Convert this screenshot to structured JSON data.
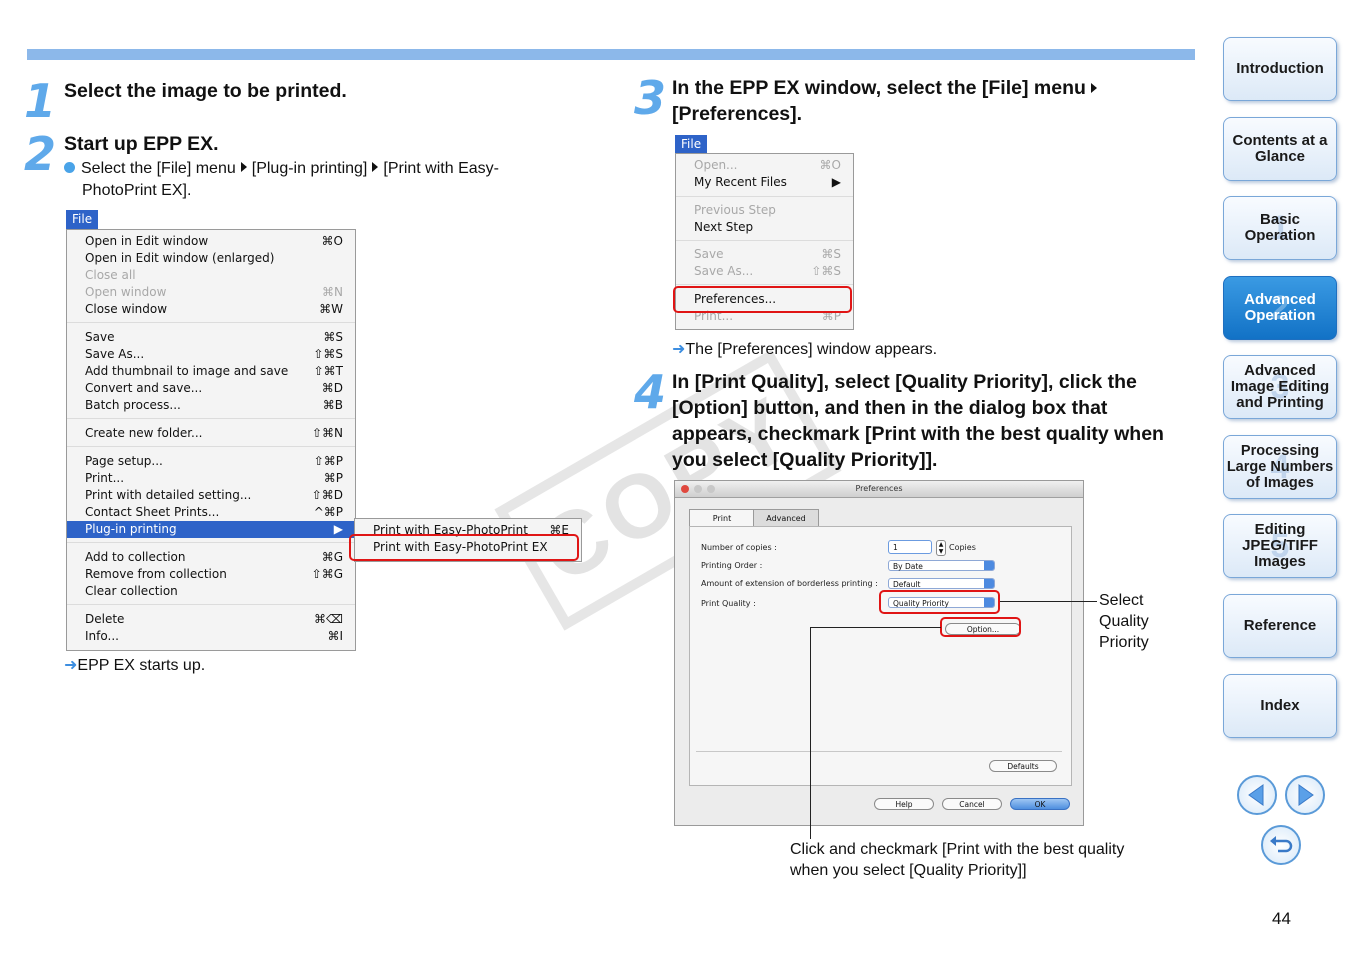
{
  "step1": {
    "num": "1",
    "title": "Select the image to be printed."
  },
  "step2": {
    "num": "2",
    "title": "Start up EPP EX.",
    "text_a": "Select the [File] menu",
    "text_b": "[Plug-in printing]",
    "text_c": "[Print with Easy-",
    "text_d": "PhotoPrint EX].",
    "result": "EPP EX starts up."
  },
  "file_menu_1": {
    "title": "File",
    "items": [
      {
        "label": "Open in Edit window",
        "shortcut": "⌘O",
        "disabled": false
      },
      {
        "label": "Open in Edit window (enlarged)",
        "shortcut": "",
        "disabled": false
      },
      {
        "label": "Close all",
        "shortcut": "",
        "disabled": true
      },
      {
        "label": "Open window",
        "shortcut": "⌘N",
        "disabled": true
      },
      {
        "label": "Close window",
        "shortcut": "⌘W",
        "disabled": false
      },
      {
        "label": "Save",
        "shortcut": "⌘S",
        "disabled": false
      },
      {
        "label": "Save As...",
        "shortcut": "⇧⌘S",
        "disabled": false
      },
      {
        "label": "Add thumbnail to image and save",
        "shortcut": "⇧⌘T",
        "disabled": false
      },
      {
        "label": "Convert and save...",
        "shortcut": "⌘D",
        "disabled": false
      },
      {
        "label": "Batch process...",
        "shortcut": "⌘B",
        "disabled": false
      },
      {
        "label": "Create new folder...",
        "shortcut": "⇧⌘N",
        "disabled": false
      },
      {
        "label": "Page setup...",
        "shortcut": "⇧⌘P",
        "disabled": false
      },
      {
        "label": "Print...",
        "shortcut": "⌘P",
        "disabled": false
      },
      {
        "label": "Print with detailed setting...",
        "shortcut": "⇧⌘D",
        "disabled": false
      },
      {
        "label": "Contact Sheet Prints...",
        "shortcut": "^⌘P",
        "disabled": false
      },
      {
        "label": "Plug-in printing",
        "shortcut": "▶",
        "disabled": false
      },
      {
        "label": "Add to collection",
        "shortcut": "⌘G",
        "disabled": false
      },
      {
        "label": "Remove from collection",
        "shortcut": "⇧⌘G",
        "disabled": false
      },
      {
        "label": "Clear collection",
        "shortcut": "",
        "disabled": false
      },
      {
        "label": "Delete",
        "shortcut": "⌘⌫",
        "disabled": false
      },
      {
        "label": "Info...",
        "shortcut": "⌘I",
        "disabled": false
      }
    ],
    "submenu": [
      {
        "label": "Print with Easy-PhotoPrint",
        "shortcut": "⌘E"
      },
      {
        "label": "Print with Easy-PhotoPrint EX",
        "shortcut": ""
      }
    ]
  },
  "step3": {
    "num": "3",
    "title_a": "In the EPP EX window, select the [File] menu",
    "title_b": "[Preferences].",
    "result": "The [Preferences] window appears."
  },
  "file_menu_2": {
    "title": "File",
    "items": [
      {
        "label": "Open...",
        "shortcut": "⌘O",
        "disabled": true
      },
      {
        "label": "My Recent Files",
        "shortcut": "▶",
        "disabled": false
      },
      {
        "label": "Previous Step",
        "shortcut": "",
        "disabled": true
      },
      {
        "label": "Next Step",
        "shortcut": "",
        "disabled": false
      },
      {
        "label": "Save",
        "shortcut": "⌘S",
        "disabled": true
      },
      {
        "label": "Save As...",
        "shortcut": "⇧⌘S",
        "disabled": true
      },
      {
        "label": "Preferences...",
        "shortcut": "",
        "disabled": false
      },
      {
        "label": "Print...",
        "shortcut": "⌘P",
        "disabled": true
      }
    ]
  },
  "step4": {
    "num": "4",
    "lines": [
      "In [Print Quality], select [Quality Priority], click the",
      "[Option] button, and then in the dialog box that",
      "appears, checkmark [Print with the best quality when",
      "you select [Quality Priority]]."
    ]
  },
  "prefs": {
    "title": "Preferences",
    "tabs": [
      "Print",
      "Advanced"
    ],
    "copies_label": "Number of copies :",
    "copies_value": "1",
    "copies_unit": "Copies",
    "order_label": "Printing Order :",
    "order_value": "By Date",
    "ext_label": "Amount of extension of borderless printing :",
    "ext_value": "Default",
    "quality_label": "Print Quality :",
    "quality_value": "Quality Priority",
    "option_btn": "Option...",
    "defaults_btn": "Defaults",
    "help_btn": "Help",
    "cancel_btn": "Cancel",
    "ok_btn": "OK"
  },
  "callouts": {
    "select_qp": [
      "Select",
      "Quality",
      "Priority"
    ],
    "click_checkmark": [
      "Click and checkmark [Print with the best quality",
      "when you select [Quality Priority]]"
    ]
  },
  "watermark": "COPY",
  "nav": [
    {
      "label": "Introduction",
      "num": ""
    },
    {
      "label": "Contents at a Glance",
      "num": ""
    },
    {
      "label": "Basic Operation",
      "num": "1"
    },
    {
      "label": "Advanced Operation",
      "num": "2"
    },
    {
      "label": "Advanced Image Editing and Printing",
      "num": "3"
    },
    {
      "label": "Processing Large Numbers of Images",
      "num": "4"
    },
    {
      "label": "Editing JPEG/TIFF Images",
      "num": "5"
    },
    {
      "label": "Reference",
      "num": ""
    },
    {
      "label": "Index",
      "num": ""
    }
  ],
  "page_number": "44",
  "colors": {
    "accent": "#5fa9ea",
    "bar": "#8cb8ea",
    "highlight": "#e01515",
    "menu_select": "#2e63c8"
  }
}
